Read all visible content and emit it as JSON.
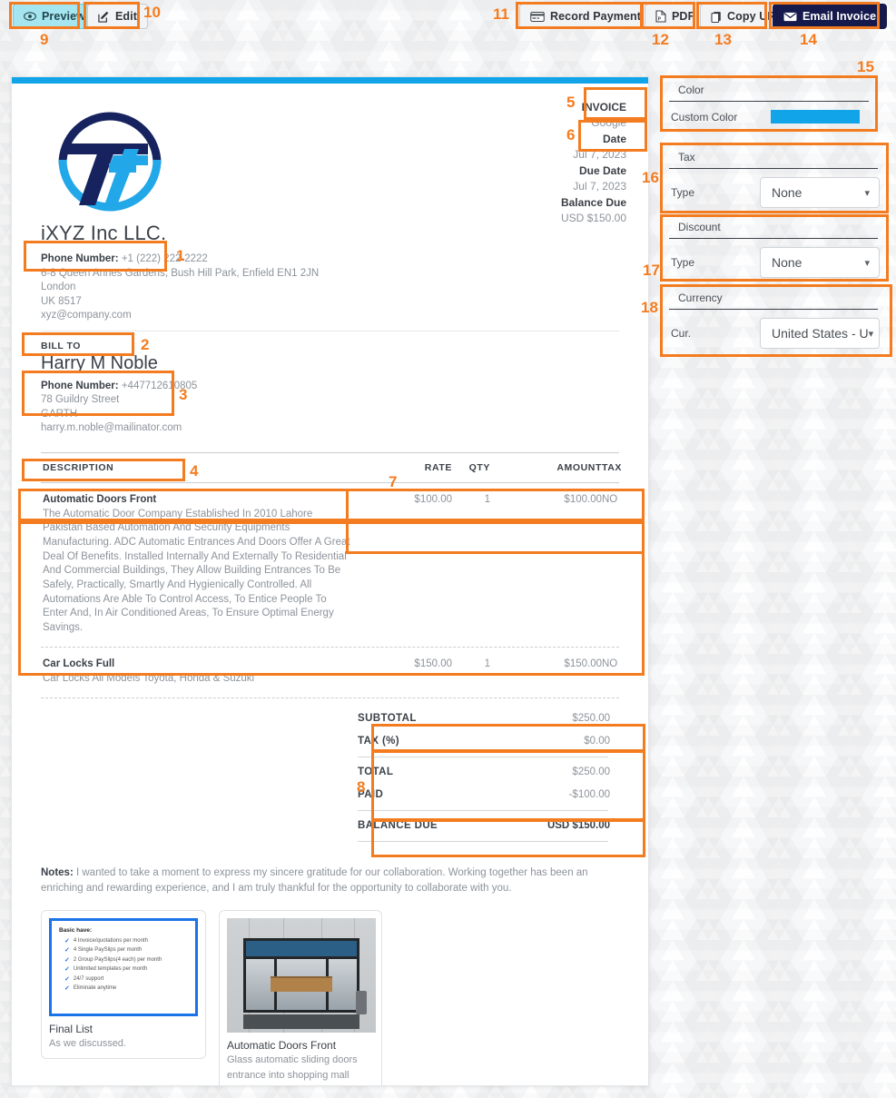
{
  "toolbar": {
    "preview_label": "Preview",
    "edit_label": "Edit",
    "record_payment_label": "Record Payment",
    "pdf_label": "PDF",
    "copy_url_label": "Copy URL",
    "email_invoice_label": "Email Invoice"
  },
  "annotations": {
    "n1": "1",
    "n2": "2",
    "n3": "3",
    "n4": "4",
    "n5": "5",
    "n6": "6",
    "n7": "7",
    "n8": "8",
    "n9": "9",
    "n10": "10",
    "n11": "11",
    "n12": "12",
    "n13": "13",
    "n14": "14",
    "n15": "15",
    "n16": "16",
    "n17": "17",
    "n18": "18"
  },
  "invoice": {
    "accent_color": "#12a4e8",
    "company": {
      "name": "iXYZ Inc LLC.",
      "phone_label": "Phone Number:",
      "phone": "+1 (222) 222-2222",
      "address_line1": "6-8 Queen Annes Gardens, Bush Hill Park, Enfield EN1 2JN",
      "address_line2": "London",
      "address_line3": "UK 8517",
      "email": "xyz@company.com"
    },
    "bill_to": {
      "label": "BILL TO",
      "name": "Harry M Noble",
      "phone_label": "Phone Number:",
      "phone": "+447712610805",
      "address_line1": "78 Guildry Street",
      "address_line2": "GARTH",
      "email": "harry.m.noble@mailinator.com"
    },
    "meta": {
      "invoice_label": "INVOICE",
      "invoice_value": "Google",
      "date_label": "Date",
      "date_value": "Jul 7, 2023",
      "due_date_label": "Due Date",
      "due_date_value": "Jul 7, 2023",
      "balance_due_label": "Balance Due",
      "balance_due_value": "USD $150.00"
    },
    "table": {
      "headers": [
        "DESCRIPTION",
        "RATE",
        "QTY",
        "AMOUNT",
        "TAX"
      ],
      "rows": [
        {
          "title": "Automatic Doors Front",
          "description": "The Automatic Door Company Established In 2010 Lahore Pakistan Based Automation And Security Equipments Manufacturing. ADC Automatic Entrances And Doors Offer A Great Deal Of Benefits. Installed Internally And Externally To Residential And Commercial Buildings, They Allow Building Entrances To Be Safely, Practically, Smartly And Hygienically Controlled. All Automations Are Able To Control Access, To Entice People To Enter And, In Air Conditioned Areas, To Ensure Optimal Energy Savings.",
          "rate": "$100.00",
          "qty": "1",
          "amount": "$100.00",
          "tax": "NO"
        },
        {
          "title": "Car Locks Full",
          "description": "Car Locks All Models Toyota, Honda & Suzuki",
          "rate": "$150.00",
          "qty": "1",
          "amount": "$150.00",
          "tax": "NO"
        }
      ]
    },
    "totals": {
      "subtotal_label": "SUBTOTAL",
      "subtotal_value": "$250.00",
      "tax_label": "TAX (%)",
      "tax_value": "$0.00",
      "total_label": "TOTAL",
      "total_value": "$250.00",
      "paid_label": "PAID",
      "paid_value": "-$100.00",
      "balance_due_label": "BALANCE DUE",
      "balance_due_value": "USD $150.00"
    },
    "notes": {
      "label": "Notes:",
      "text": " I wanted to take a moment to express my sincere gratitude for our collaboration. Working together has been an enriching and rewarding experience, and I am truly thankful for the opportunity to collaborate with you."
    },
    "attachments": [
      {
        "title": "Final List",
        "subtitle": "As we discussed.",
        "thumb_type": "document",
        "doc_heading": "Basic have:",
        "doc_items": [
          "4 Invoice/quotations per month",
          "4 Single PaySlips per month",
          "2 Group PaySlips(4 each) per month",
          "Unlimited templates per month",
          "24/7 support",
          "Eliminate anytime"
        ]
      },
      {
        "title": "Automatic Doors Front",
        "subtitle_line1": "Glass automatic sliding doors",
        "subtitle_line2": "entrance into shopping mall",
        "thumb_type": "photo"
      }
    ]
  },
  "panels": {
    "color": {
      "title": "Color",
      "row_label": "Custom Color",
      "value_hex": "#12a4e8"
    },
    "tax": {
      "title": "Tax",
      "row_label": "Type",
      "value": "None"
    },
    "discount": {
      "title": "Discount",
      "row_label": "Type",
      "value": "None"
    },
    "currency": {
      "title": "Currency",
      "row_label": "Cur.",
      "value": "United States - U"
    }
  }
}
